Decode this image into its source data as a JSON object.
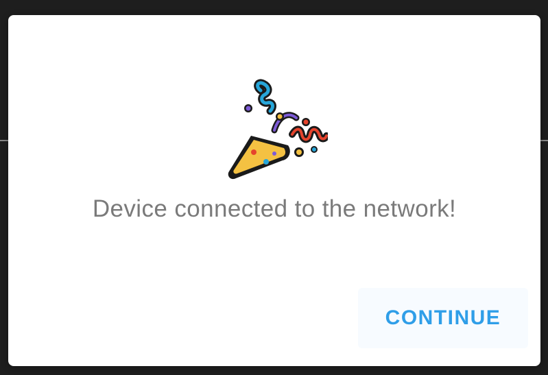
{
  "dialog": {
    "icon": "party-popper-icon",
    "message": "Device connected to the network!",
    "continue_label": "CONTINUE"
  },
  "colors": {
    "accent": "#2f9ee8",
    "message_text": "#7a7a7a",
    "dialog_bg": "#ffffff",
    "backdrop": "#1e1e1e",
    "popper_cone": "#f4c142",
    "confetti_blue": "#27a6d9",
    "confetti_red": "#e5432c",
    "confetti_purple": "#7d5bd6"
  }
}
